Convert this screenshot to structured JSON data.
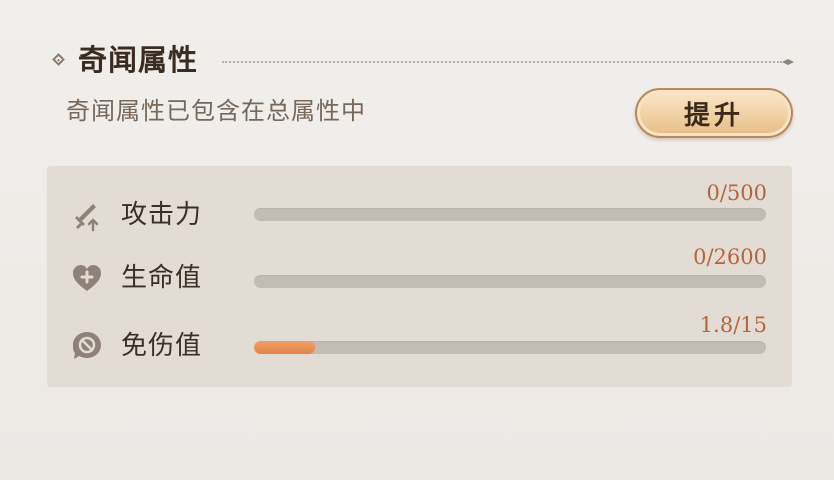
{
  "section": {
    "title": "奇闻属性",
    "subtitle": "奇闻属性已包含在总属性中",
    "upgrade_label": "提升"
  },
  "stats": [
    {
      "icon": "sword-up-icon",
      "label": "攻击力",
      "value_text": "0/500",
      "current": 0,
      "max": 500
    },
    {
      "icon": "heart-plus-icon",
      "label": "生命值",
      "value_text": "0/2600",
      "current": 0,
      "max": 2600
    },
    {
      "icon": "no-damage-shield-icon",
      "label": "免伤值",
      "value_text": "1.8/15",
      "current": 1.8,
      "max": 15
    }
  ],
  "colors": {
    "accent": "#b8643a",
    "bar_fill": "#e8894e",
    "bar_track": "#c3bcb6",
    "icon": "#8e8278",
    "title": "#3b2c22"
  }
}
